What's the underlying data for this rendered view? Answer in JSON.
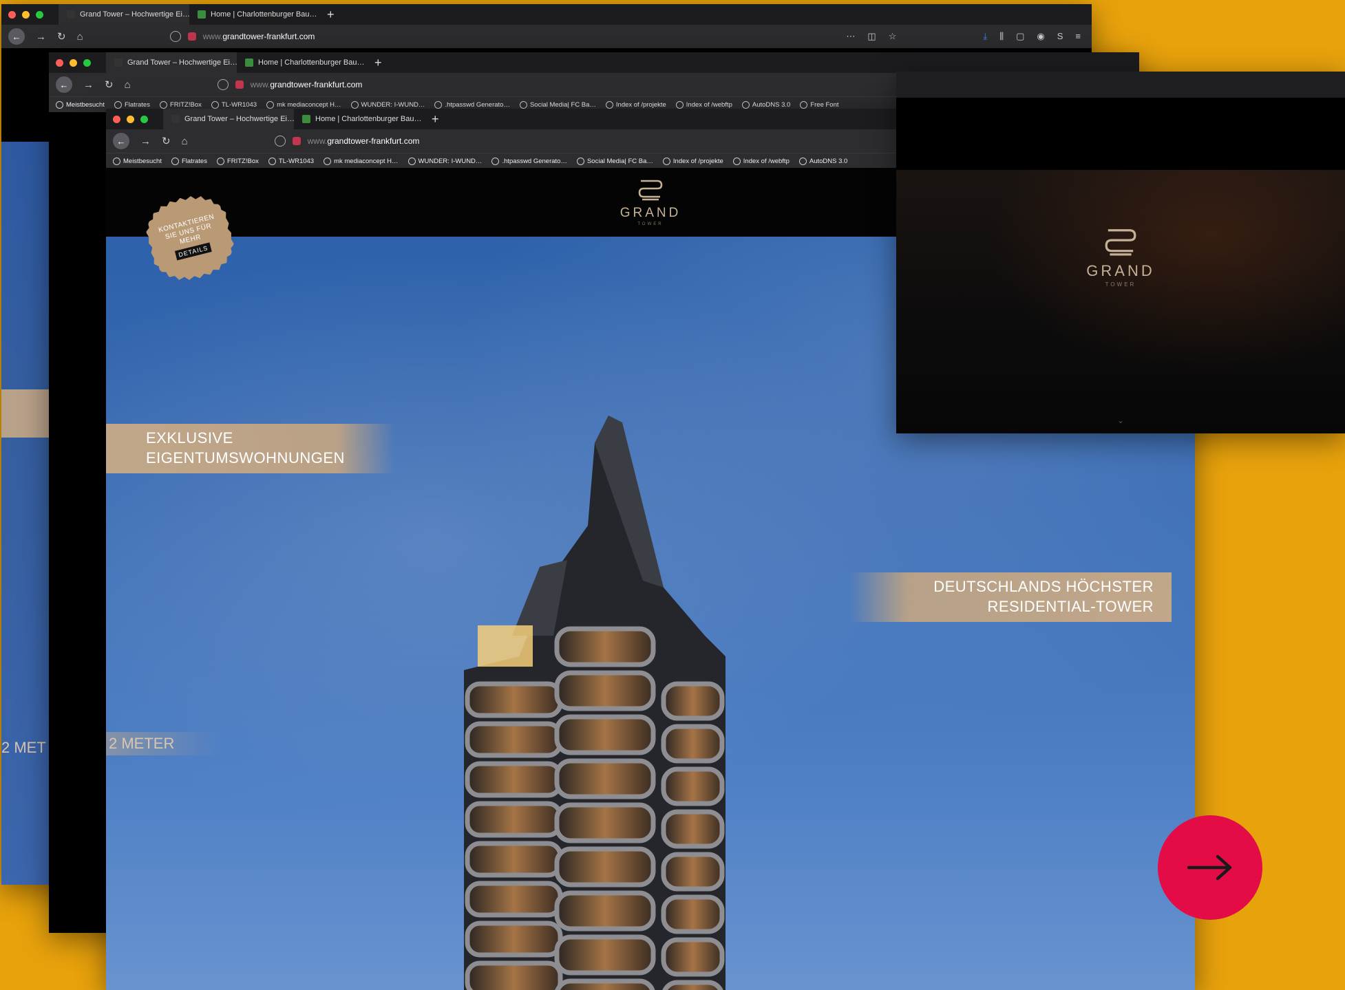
{
  "tabs": {
    "tab1": "Grand Tower – Hochwertige Ei…",
    "tab2": "Home | Charlottenburger Bau…"
  },
  "url": {
    "prefix": "www.",
    "domain": "grandtower-frankfurt.com"
  },
  "bookmarks": [
    "Meistbesucht",
    "Flatrates",
    "FRITZ!Box",
    "TL-WR1043",
    "mk mediaconcept H…",
    "WUNDER: I-WUND…",
    ".htpasswd Generato…",
    "Social Media| FC Ba…",
    "Index of /projekte",
    "Index of /webftp",
    "AutoDNS 3.0",
    "Free Font"
  ],
  "logo": {
    "title": "GRAND",
    "subtitle": "TOWER"
  },
  "seal": {
    "text": "KONTAKTIEREN SIE UNS FÜR MEHR",
    "button": "DETAILS"
  },
  "ribbons": {
    "left_line1": "EXKLUSIVE",
    "left_line2": "EIGENTUMSWOHNUNGEN",
    "right_line1": "DEUTSCHLANDS HÖCHSTER",
    "right_line2": "RESIDENTIAL-TOWER",
    "meter": "2 METER",
    "meter_back": "2 MET"
  },
  "colors": {
    "background": "#E8A20C",
    "accent": "#E40C47",
    "gold": "#C6B197"
  },
  "next_button": {
    "icon": "arrow-right-icon"
  }
}
